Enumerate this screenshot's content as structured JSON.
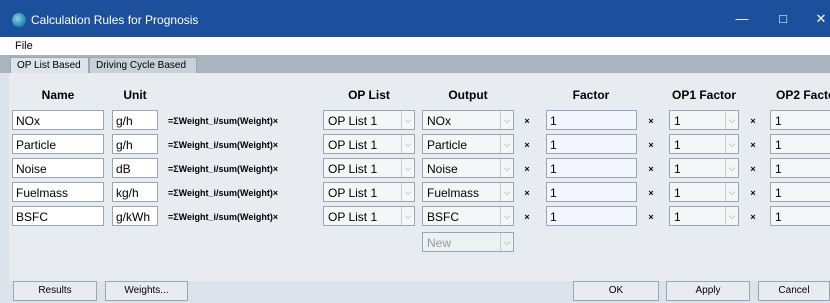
{
  "window": {
    "title": "Calculation Rules for Prognosis",
    "minimize": "—",
    "maximize": "□",
    "close": "✕"
  },
  "menu": {
    "file": "File"
  },
  "tabs": [
    {
      "label": "OP List Based"
    },
    {
      "label": "Driving Cycle Based"
    }
  ],
  "headers": {
    "name": "Name",
    "unit": "Unit",
    "oplist": "OP List",
    "output": "Output",
    "factor": "Factor",
    "op1factor": "OP1 Factor",
    "op2factor": "OP2 Facto"
  },
  "formula": "=ΣWeight_i/sum(Weight)×",
  "times": "×",
  "chevron": "⌵",
  "rows": [
    {
      "name": "NOx",
      "unit": "g/h",
      "oplist": "OP List 1",
      "output": "NOx",
      "factor": "1",
      "op1": "1",
      "op2": "1"
    },
    {
      "name": "Particle",
      "unit": "g/h",
      "oplist": "OP List 1",
      "output": "Particle",
      "factor": "1",
      "op1": "1",
      "op2": "1"
    },
    {
      "name": "Noise",
      "unit": "dB",
      "oplist": "OP List 1",
      "output": "Noise",
      "factor": "1",
      "op1": "1",
      "op2": "1"
    },
    {
      "name": "Fuelmass",
      "unit": "kg/h",
      "oplist": "OP List 1",
      "output": "Fuelmass",
      "factor": "1",
      "op1": "1",
      "op2": "1"
    },
    {
      "name": "BSFC",
      "unit": "g/kWh",
      "oplist": "OP List 1",
      "output": "BSFC",
      "factor": "1",
      "op1": "1",
      "op2": "1"
    }
  ],
  "new_output": "New",
  "buttons": {
    "results": "Results",
    "weights": "Weights...",
    "ok": "OK",
    "apply": "Apply",
    "cancel": "Cancel"
  }
}
